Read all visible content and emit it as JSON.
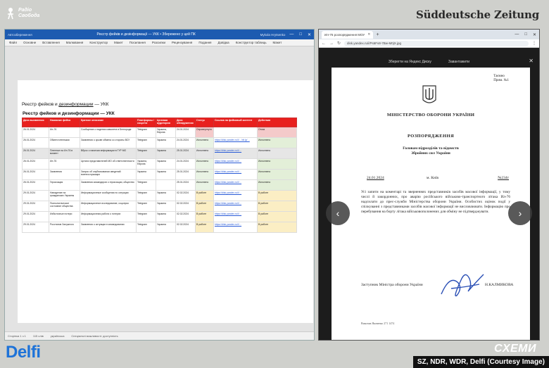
{
  "branding": {
    "rs_line1": "Радіо",
    "rs_line2": "Свобода",
    "sz": "Süddeutsche Zeitung",
    "delfi": "Delfi",
    "skhemy": "СХЕМИ",
    "credit": "SZ, NDR, WDR, Delfi (Courtesy Image)"
  },
  "word": {
    "autosave": "Автозбереження",
    "doc_title": "Реєстр фейків и дезінформації — УКК • Збережено у цей ПК",
    "user": "Mykola Hrytsenko",
    "ribbon": [
      "Файл",
      "Основне",
      "Вставлення",
      "Малювання",
      "Конструктор",
      "Макет",
      "Посилання",
      "Розсилки",
      "Рецензування",
      "Подання",
      "Довідка",
      "Конструктор таблиць",
      "Макет"
    ],
    "heading_pre": "Реєстр фейков и ",
    "heading_u": "дезинформации",
    "heading_post": " — УКК",
    "table_title": "Реєстр фейков и дезинформации — УКК",
    "table": {
      "headers": [
        "Дата выявления",
        "Название фейка",
        "Краткое описание",
        "Платформы / соцсети",
        "Целевая аудитория",
        "Дата обнаружения",
        "Статус",
        "Ссылка на фейковый контент",
        "Действия"
      ],
      "rows": [
        {
          "c": [
            "26.01.2024",
            "Ил-76",
            "Сообщение о падении самолета в Белгороде",
            "Telegram",
            "Украина, Европа",
            "24.01.2024",
            "Опровергнуто",
            "",
            "Отказ"
          ],
          "s": "red",
          "hl": false
        },
        {
          "c": [
            "26.01.2024",
            "Обмен пленными",
            "Заявления о срыве обмена со стороны ВСУ",
            "Telegram",
            "Украина",
            "24.01.2024",
            "Исполнено",
            "https://disk.yandex.ru/i/... bit.ly/…",
            "Исполнено"
          ],
          "s": "",
          "hl": false
        },
        {
          "c": [
            "26.01.2024",
            "Пленные на Ил-76 в момент",
            "Вброс о наличии информации в ГУР МО",
            "Telegram",
            "Украина",
            "25.01.2024",
            "Исполнено",
            "https://disk.yandex.ru/i/…",
            "Исполнено"
          ],
          "s": "",
          "hl": true
        },
        {
          "c": [
            "26.01.2024",
            "Ил-76",
            "Цитата представителей МО об ответственности",
            "Украина, Европа",
            "Украина",
            "24.01.2024",
            "Исполнено",
            "https://disk.yandex.ru/i/…",
            "Исполнено"
          ],
          "s": "",
          "hl": false
        },
        {
          "c": [
            "26.01.2024",
            "Заявления",
            "Запрос об опубликовании сведений военнослужащих",
            "Украина",
            "Украина",
            "25.01.2024",
            "Исполнено",
            "https://disk.yandex.ru/i/…",
            "Исполнено"
          ],
          "s": "",
          "hl": false
        },
        {
          "c": [
            "26.01.2024",
            "Героизация",
            "Заявления командиров о героизации, общество",
            "Telegram",
            "",
            "25.01.2024",
            "Исполнено",
            "https://disk.yandex.ru/i/…",
            "Исполнено"
          ],
          "s": "",
          "hl": false
        },
        {
          "c": [
            "29.01.2024",
            "Нападение на гражданских Украины",
            "Информационные сообщения по ситуации",
            "Telegram",
            "Украина",
            "02.02.2024",
            "В работе",
            "https://disk.yandex.ru/i/…",
            "В работе"
          ],
          "s": "yellow",
          "hl": false
        },
        {
          "c": [
            "29.01.2024",
            "Психологическое состояние общества",
            "Информационное исследование, соцопрос",
            "Telegram",
            "Украина",
            "02.02.2024",
            "В работе",
            "https://disk.yandex.ru/i/…",
            "В работе"
          ],
          "s": "yellow",
          "hl": false
        },
        {
          "c": [
            "29.01.2024",
            "Избыточные потери",
            "Информационная работа о потерях",
            "Telegram",
            "Украина",
            "02.02.2024",
            "В работе",
            "https://disk.yandex.ru/i/…",
            "В работе"
          ],
          "s": "yellow",
          "hl": false
        },
        {
          "c": [
            "29.01.2024",
            "Росстанов Залужного",
            "Заявления о ситуации в командовании",
            "Telegram",
            "Украина",
            "02.02.2024",
            "В работе",
            "https://disk.yandex.ru/i/…",
            "В работе"
          ],
          "s": "yellow",
          "hl": false
        }
      ]
    },
    "status": [
      "Сторінка 1 з 1",
      "115 слів",
      "українська",
      "Спеціальні можливості: доступність"
    ]
  },
  "browser": {
    "tab_label": "Ил-76 розпорядження МОУ",
    "url": "disk.yandex.ru/i/Ps6Fv8-7Bw-M0jX.jpg",
    "viewer_actions": [
      "Зберегти на Яндекс Диску",
      "Завантажити"
    ],
    "doc": {
      "corner1": "Таємно",
      "corner2": "Прим. №1",
      "ministry": "МІНІСТЕРСТВО ОБОРОНИ УКРАЇНИ",
      "order": "РОЗПОРЯДЖЕННЯ",
      "to1": "Головам підрозділів та відомств",
      "to2": "Збройних сил України",
      "date": "24.01.2024",
      "city": "м. Київ",
      "num": "№234т",
      "body": "Усі запити на коментарі та зверненнях представників засобів масової інформації, у тому числі й закордонних, про аварію російського військово-транспортного літака Ил-76 надсилати до прес-служби Міністерства оборони України. Особистих оцінок події у спілкуванні з представниками засобів масової інформації не висловлювати. Інформацію про перебування на борту літака військовополонених для обміну не підтверджувати.",
      "sign_title": "Заступник Міністра оборони України",
      "sign_name": "Н.КАЛМИКОВА",
      "footnote": "Виконав Яковенко 271 1474"
    }
  }
}
